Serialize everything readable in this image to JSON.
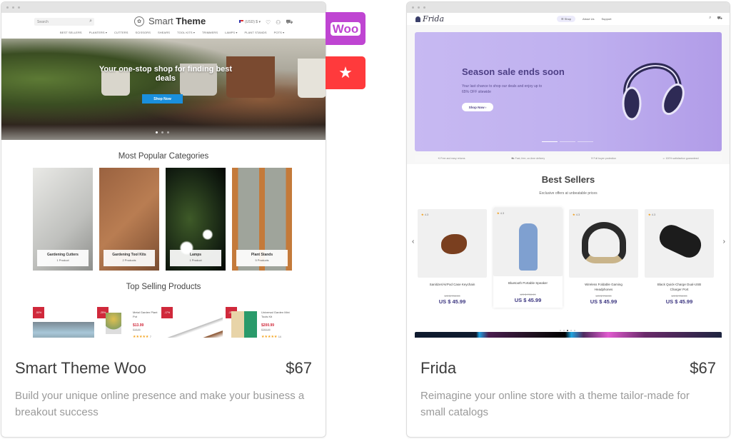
{
  "side_badges": {
    "woo_label": "Woo",
    "favorite_icon": "star-icon"
  },
  "left": {
    "store": {
      "search_placeholder": "Search",
      "logo_light": "Smart ",
      "logo_bold": "Theme",
      "currency": "(USD) $",
      "nav": [
        "BEST SELLERS",
        "PLANTERS ▾",
        "CUTTERS",
        "SCISSORS",
        "SHEARS",
        "TOOL KITS ▾",
        "TRIMMERS",
        "LAMPS ▾",
        "PLANT STANDS",
        "POTS ▾"
      ],
      "hero_title": "Your one-stop shop for finding best deals",
      "hero_button": "Shop Now",
      "categories_title": "Most Popular Categories",
      "categories": [
        {
          "name": "Gardening Cutters",
          "count": "1 Product"
        },
        {
          "name": "Gardening Tool Kits",
          "count": "2 Products"
        },
        {
          "name": "Lamps",
          "count": "1 Product"
        },
        {
          "name": "Plant Stands",
          "count": "5 Products"
        }
      ],
      "top_selling_title": "Top Selling Products",
      "products": [
        {
          "badge": "-50%",
          "name": "",
          "price": "",
          "old": ""
        },
        {
          "badge": "-25%",
          "name": "Metal Garden Plant Pot",
          "price": "$13.99",
          "old": "$18.99",
          "stars": "★★★★★",
          "reviews": "7"
        },
        {
          "badge": "-17%",
          "name": "",
          "price": "",
          "old": ""
        },
        {
          "badge": "-25%",
          "name": "Universal Garden Mini Tools Kit",
          "price": "$200.99",
          "old": "$260.99",
          "stars": "★★★★★",
          "reviews": "14"
        }
      ]
    },
    "title": "Smart Theme Woo",
    "price": "$67",
    "description": "Build your unique online presence and make your business a breakout success"
  },
  "right": {
    "store": {
      "logo": "Frida",
      "nav": [
        "Shop",
        "About Us",
        "Support"
      ],
      "hero_title": "Season sale ends soon",
      "hero_text": "Your last chance to shop our deals and enjoy up to 65% OFF sitewide",
      "hero_button": "Shop Now  ›",
      "features": [
        "Free and easy returns",
        "Fast, free, on-time delivery",
        "Full buyer protection",
        "100% satisfaction guaranteed"
      ],
      "best_title": "Best Sellers",
      "best_subtitle": "Exclusive offers at unbeatable prices",
      "products": [
        {
          "rating": "4.3",
          "name": "Sanitizer/AirPod Case Keychain",
          "old": "US $ 790.99",
          "price": "US $ 45.99"
        },
        {
          "rating": "4.3",
          "name": "Bluetooth Portable Speaker",
          "old": "US $ 790.99",
          "price": "US $ 45.99"
        },
        {
          "rating": "4.3",
          "name": "Wireless Foldable Gaming Headphones",
          "old": "US $ 790.99",
          "price": "US $ 45.99"
        },
        {
          "rating": "4.3",
          "name": "Black Quick-Charge Dual-USB Charger Port",
          "old": "US $ 790.99",
          "price": "US $ 45.99"
        }
      ]
    },
    "title": "Frida",
    "price": "$67",
    "description": "Reimagine your online store with a theme tailor-made for small catalogs"
  }
}
